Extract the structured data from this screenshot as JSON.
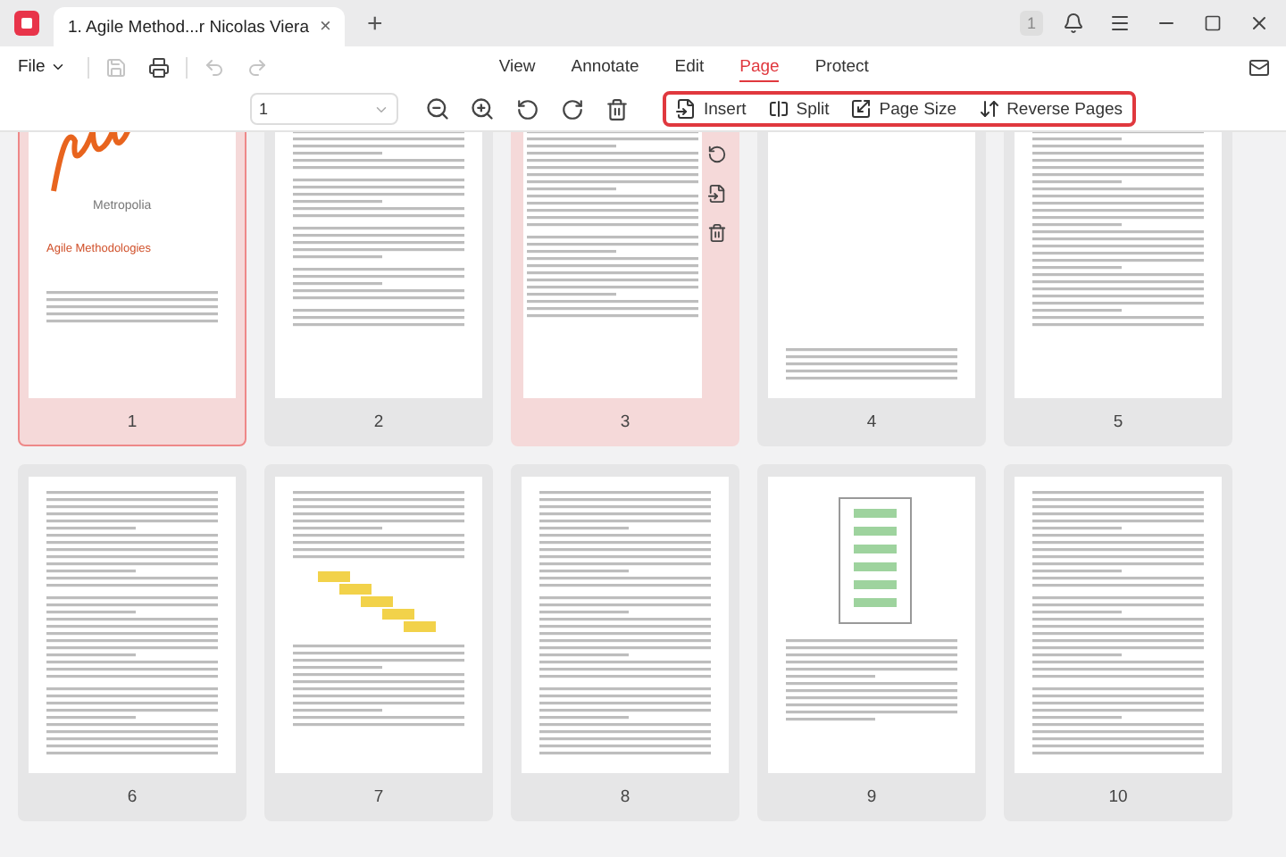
{
  "tab_bar": {
    "document_tab": {
      "title": "1. Agile Method...r Nicolas Viera",
      "close": "×"
    },
    "new_tab": "+",
    "badge": "1"
  },
  "menu_bar": {
    "file_menu": "File",
    "undo_enabled": false,
    "redo_enabled": false,
    "menus": [
      {
        "label": "View",
        "selected": false
      },
      {
        "label": "Annotate",
        "selected": false
      },
      {
        "label": "Edit",
        "selected": false
      },
      {
        "label": "Page",
        "selected": true
      },
      {
        "label": "Protect",
        "selected": false
      }
    ]
  },
  "page_toolbar": {
    "page_select": {
      "value": "1"
    },
    "page_actions": [
      {
        "kind": "insert",
        "label": "Insert"
      },
      {
        "kind": "split",
        "label": "Split"
      },
      {
        "kind": "page_size",
        "label": "Page Size"
      },
      {
        "kind": "reverse",
        "label": "Reverse Pages"
      }
    ]
  },
  "pages": [
    {
      "number": "1",
      "kind": "cover",
      "selected": true,
      "hovered": false,
      "logo_text": "Metropolia",
      "title": "Agile Methodologies"
    },
    {
      "number": "2",
      "kind": "abstract",
      "selected": false,
      "hovered": false
    },
    {
      "number": "3",
      "kind": "contents",
      "selected": false,
      "hovered": true
    },
    {
      "number": "4",
      "kind": "blank",
      "selected": false,
      "hovered": false
    },
    {
      "number": "5",
      "kind": "list",
      "selected": false,
      "hovered": false
    },
    {
      "number": "6",
      "kind": "text",
      "selected": false,
      "hovered": false
    },
    {
      "number": "7",
      "kind": "figure",
      "selected": false,
      "hovered": false
    },
    {
      "number": "8",
      "kind": "text",
      "selected": false,
      "hovered": false
    },
    {
      "number": "9",
      "kind": "diagram",
      "selected": false,
      "hovered": false
    },
    {
      "number": "10",
      "kind": "text",
      "selected": false,
      "hovered": false
    }
  ]
}
